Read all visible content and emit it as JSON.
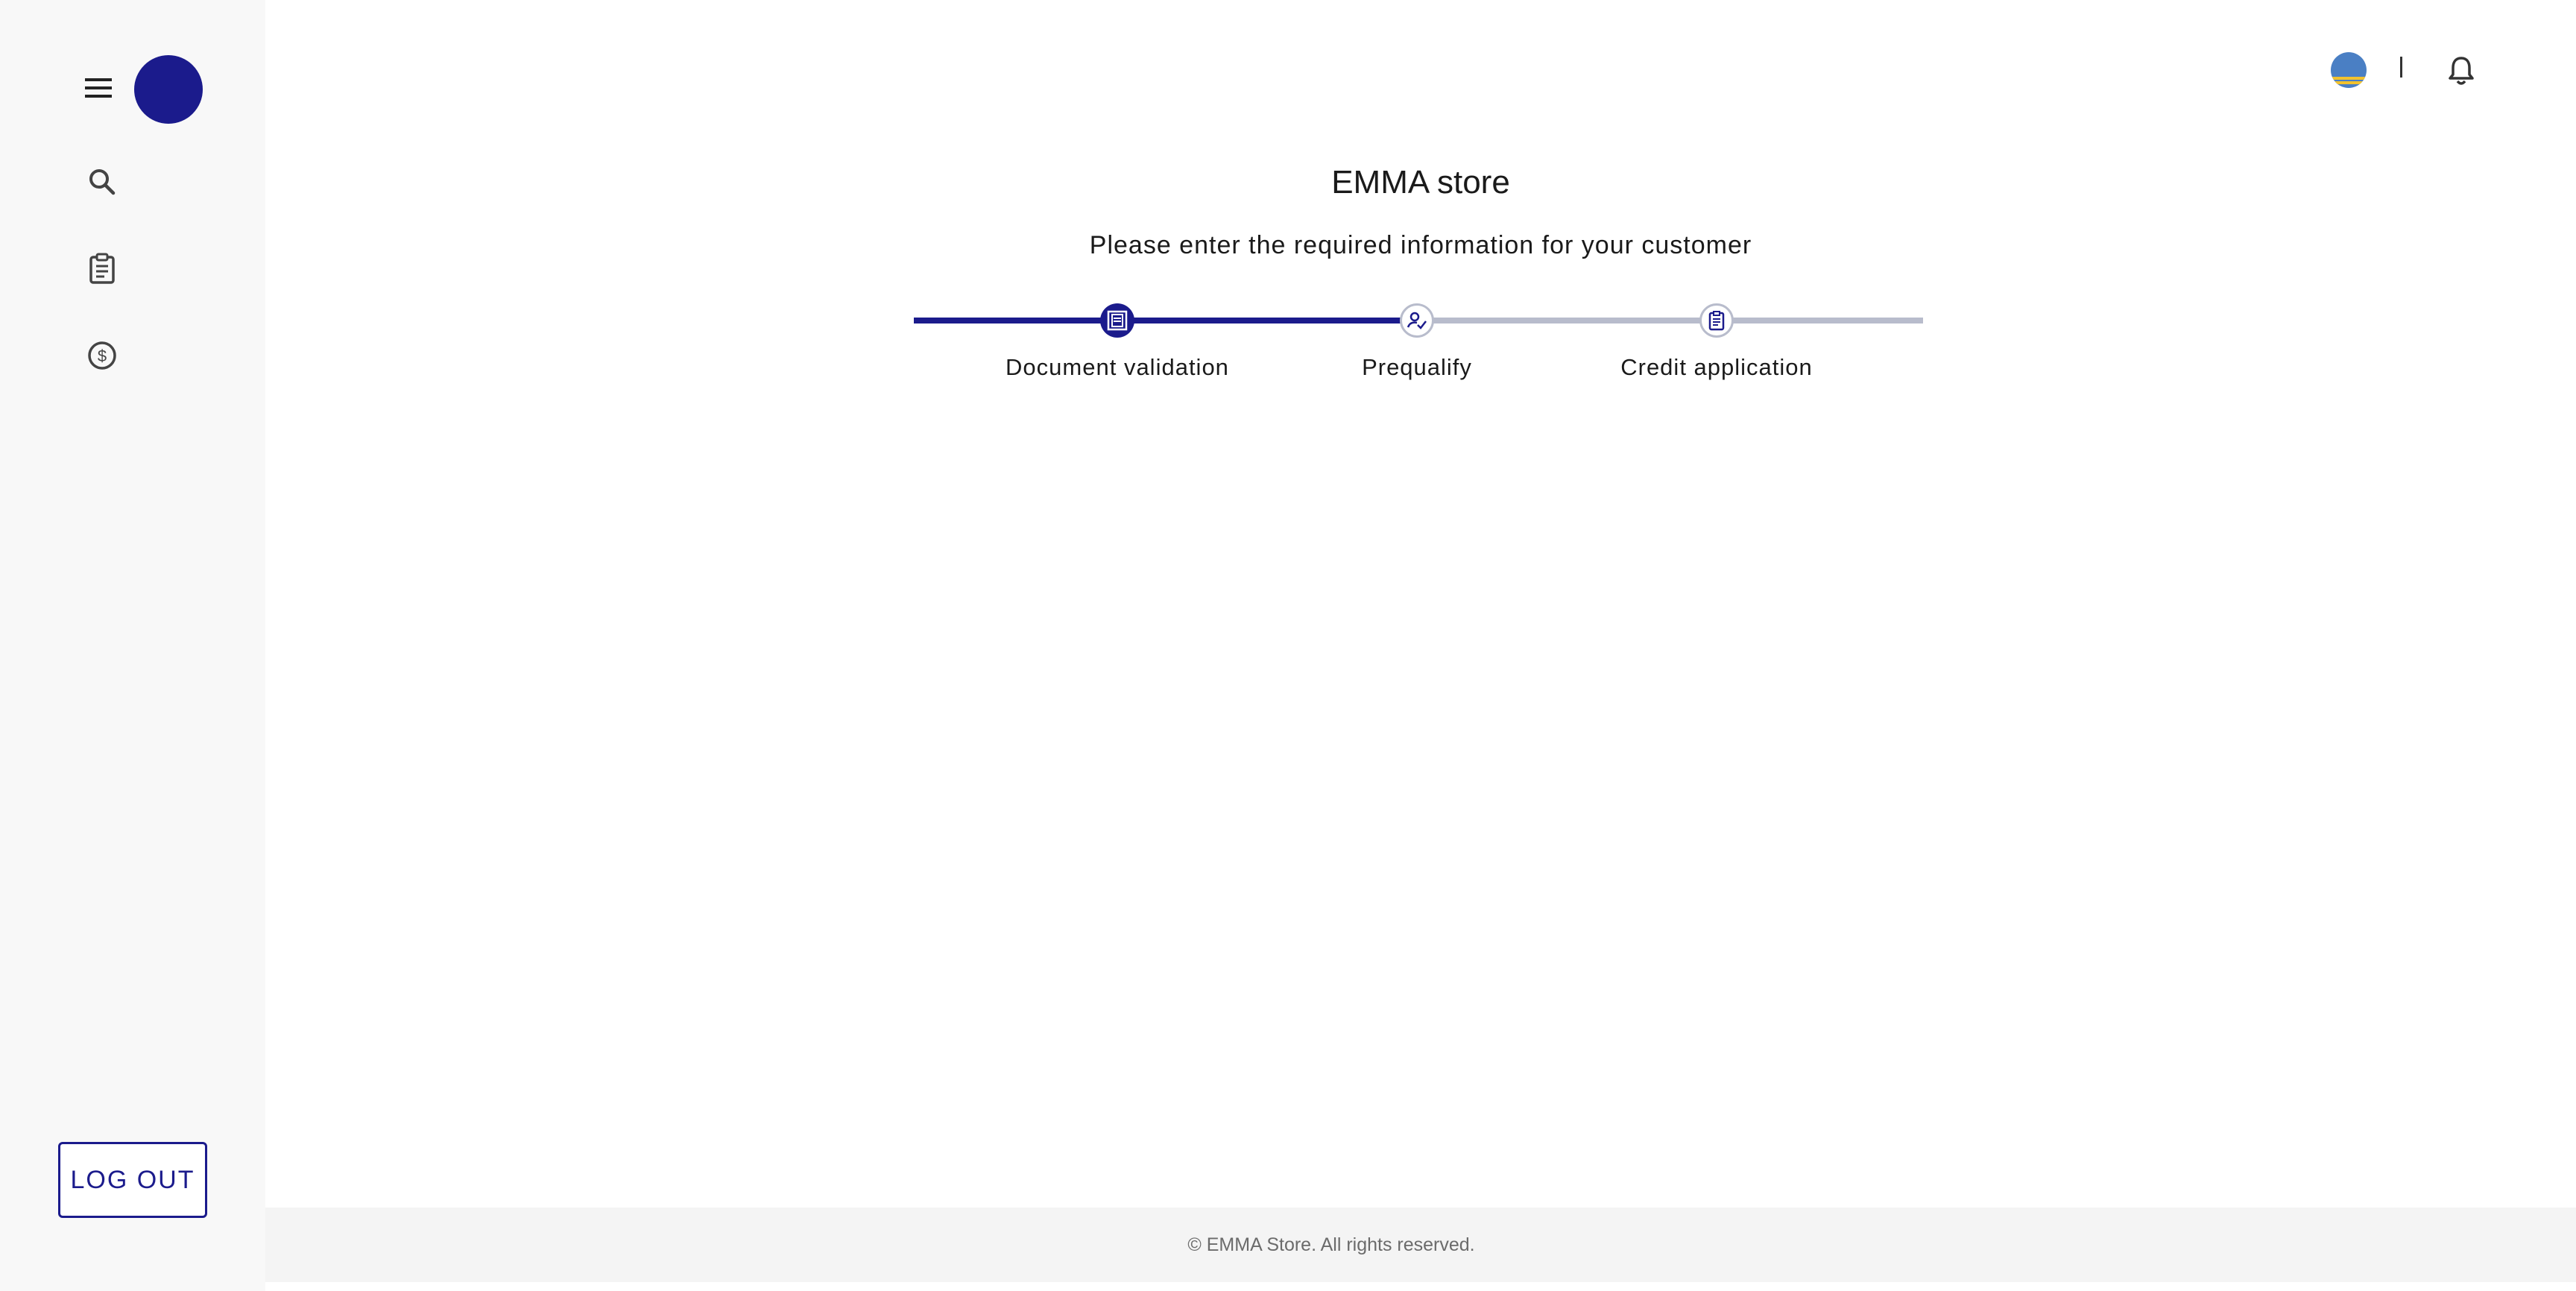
{
  "sidebar": {
    "items": [
      {
        "icon": "search-icon"
      },
      {
        "icon": "clipboard-icon"
      },
      {
        "icon": "dollar-icon"
      }
    ],
    "logout_label": "LOG OUT"
  },
  "header": {
    "divider": "|"
  },
  "main": {
    "title": "EMMA store",
    "subtitle": "Please enter the required information for your customer",
    "steps": [
      {
        "label": "Document validation",
        "icon": "document-scan-icon",
        "status": "active"
      },
      {
        "label": "Prequalify",
        "icon": "user-check-icon",
        "status": "pending"
      },
      {
        "label": "Credit application",
        "icon": "clipboard-icon",
        "status": "pending"
      }
    ]
  },
  "footer": {
    "text": "© EMMA Store. All rights reserved."
  },
  "colors": {
    "primary": "#1b1b8c",
    "track_inactive": "#b8bccc",
    "sidebar_bg": "#f8f8f8",
    "footer_bg": "#f4f4f4"
  }
}
